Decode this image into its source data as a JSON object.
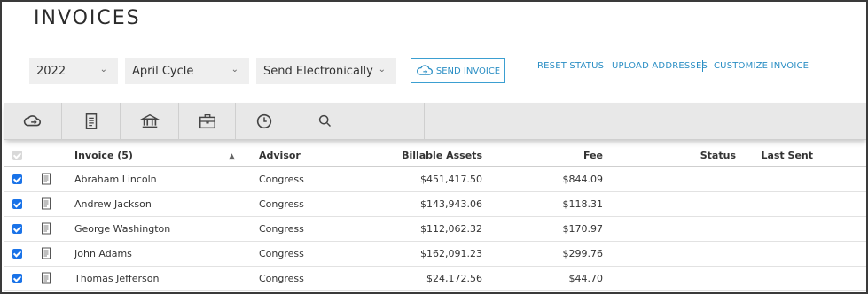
{
  "page": {
    "title": "INVOICES"
  },
  "filters": {
    "year": "2022",
    "cycle": "April Cycle",
    "delivery": "Send Electronically"
  },
  "actions": {
    "send_invoice": "SEND INVOICE",
    "reset_status": "RESET STATUS",
    "upload_addresses": "UPLOAD ADDRESSES",
    "customize_invoice": "CUSTOMIZE INVOICE"
  },
  "toolbar": {
    "icons": [
      "cloud-icon",
      "document-icon",
      "bank-icon",
      "briefcase-icon",
      "clock-icon",
      "search-icon"
    ]
  },
  "table": {
    "headers": {
      "invoice": "Invoice (5)",
      "advisor": "Advisor",
      "billable_assets": "Billable Assets",
      "fee": "Fee",
      "status": "Status",
      "last_sent": "Last Sent"
    },
    "rows": [
      {
        "name": "Abraham Lincoln",
        "advisor": "Congress",
        "assets": "$451,417.50",
        "fee": "$844.09",
        "status": "",
        "last_sent": "",
        "checked": true
      },
      {
        "name": "Andrew Jackson",
        "advisor": "Congress",
        "assets": "$143,943.06",
        "fee": "$118.31",
        "status": "",
        "last_sent": "",
        "checked": true
      },
      {
        "name": "George Washington",
        "advisor": "Congress",
        "assets": "$112,062.32",
        "fee": "$170.97",
        "status": "",
        "last_sent": "",
        "checked": true
      },
      {
        "name": "John Adams",
        "advisor": "Congress",
        "assets": "$162,091.23",
        "fee": "$299.76",
        "status": "",
        "last_sent": "",
        "checked": true
      },
      {
        "name": "Thomas Jefferson",
        "advisor": "Congress",
        "assets": "$24,172.56",
        "fee": "$44.70",
        "status": "",
        "last_sent": "",
        "checked": true
      }
    ]
  },
  "colors": {
    "accent": "#2a8ec4",
    "checkbox": "#1a73e8",
    "toolbar": "#e8e8e8"
  }
}
